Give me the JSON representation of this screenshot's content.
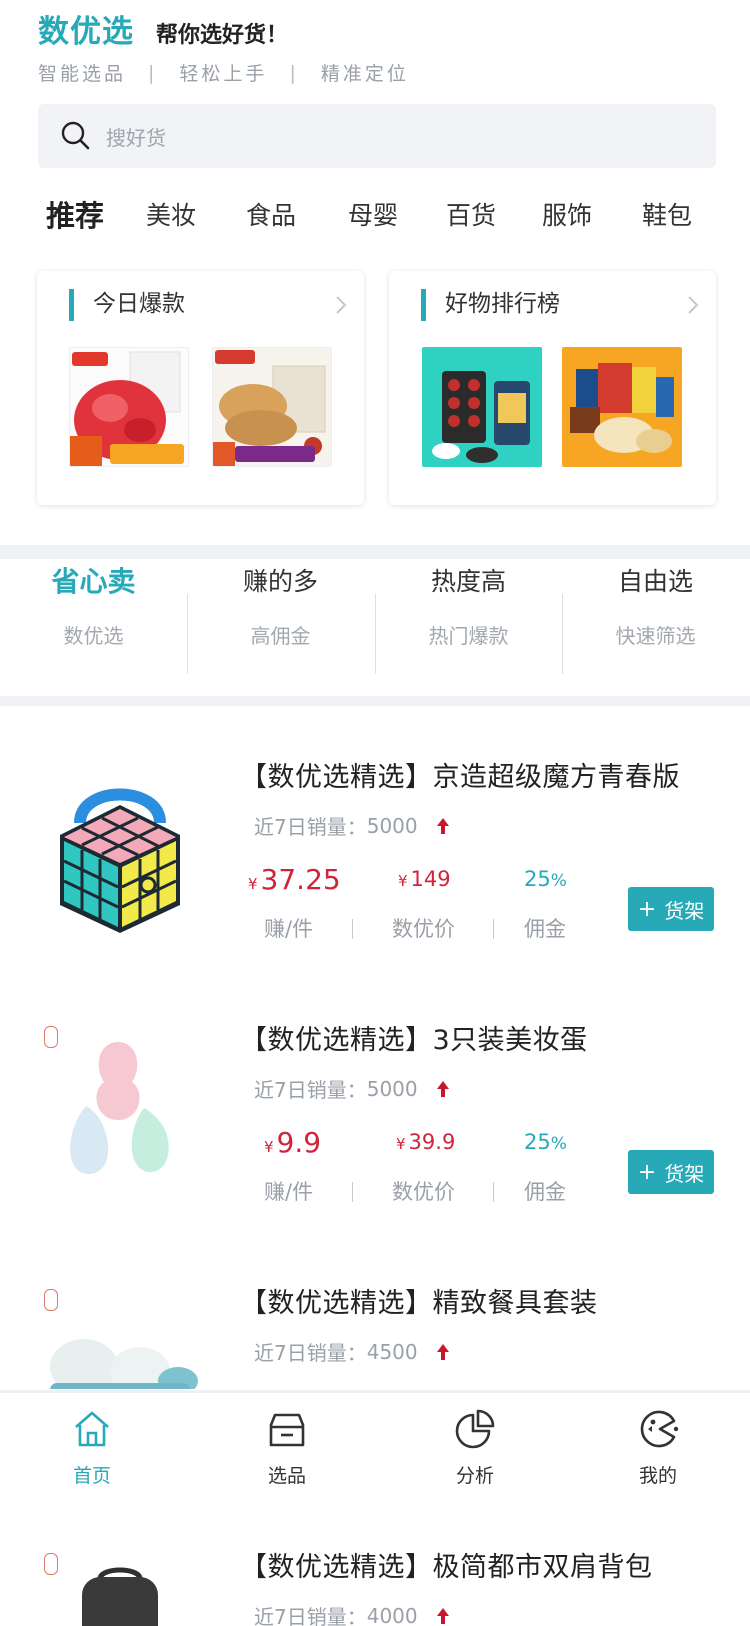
{
  "header": {
    "brand": "数优选",
    "slogan": "帮你选好货！",
    "tags": [
      "智能选品",
      "轻松上手",
      "精准定位"
    ]
  },
  "search": {
    "placeholder": "搜好货"
  },
  "categories": [
    "推荐",
    "美妆",
    "食品",
    "母婴",
    "百货",
    "服饰",
    "鞋包"
  ],
  "feature_cards": [
    {
      "title": "今日爆款"
    },
    {
      "title": "好物排行榜"
    }
  ],
  "shortcuts": [
    {
      "title": "省心卖",
      "subtitle": "数优选"
    },
    {
      "title": "赚的多",
      "subtitle": "高佣金"
    },
    {
      "title": "热度高",
      "subtitle": "热门爆款"
    },
    {
      "title": "自由选",
      "subtitle": "快速筛选"
    }
  ],
  "products": [
    {
      "title": "【数优选精选】京造超级魔方青春版",
      "sales_label": "近7日销量：",
      "sales": "5000",
      "earn_currency": "¥",
      "earn": "37.25",
      "price_currency": "¥",
      "price": "149",
      "commission": "25",
      "commission_unit": "%",
      "earn_label": "赚/件",
      "price_label": "数优价",
      "commission_label": "佣金",
      "button": "货架"
    },
    {
      "title": "【数优选精选】3只装美妆蛋",
      "sales_label": "近7日销量：",
      "sales": "5000",
      "earn_currency": "¥",
      "earn": "9.9",
      "price_currency": "¥",
      "price": "39.9",
      "commission": "25",
      "commission_unit": "%",
      "earn_label": "赚/件",
      "price_label": "数优价",
      "commission_label": "佣金",
      "button": "货架"
    },
    {
      "title": "【数优选精选】精致餐具套装",
      "sales_label": "近7日销量：",
      "sales": "4500"
    },
    {
      "title": "【数优选精选】极简都市双肩背包",
      "sales_label": "近7日销量：",
      "sales": "4000"
    }
  ],
  "tabbar": [
    {
      "label": "首页",
      "icon": "home-icon",
      "active": true
    },
    {
      "label": "选品",
      "icon": "box-icon",
      "active": false
    },
    {
      "label": "分析",
      "icon": "pie-chart-icon",
      "active": false
    },
    {
      "label": "我的",
      "icon": "profile-icon",
      "active": false
    }
  ],
  "colors": {
    "accent": "#27a9b8",
    "price": "#d0243a",
    "muted": "#9aa0a8"
  }
}
